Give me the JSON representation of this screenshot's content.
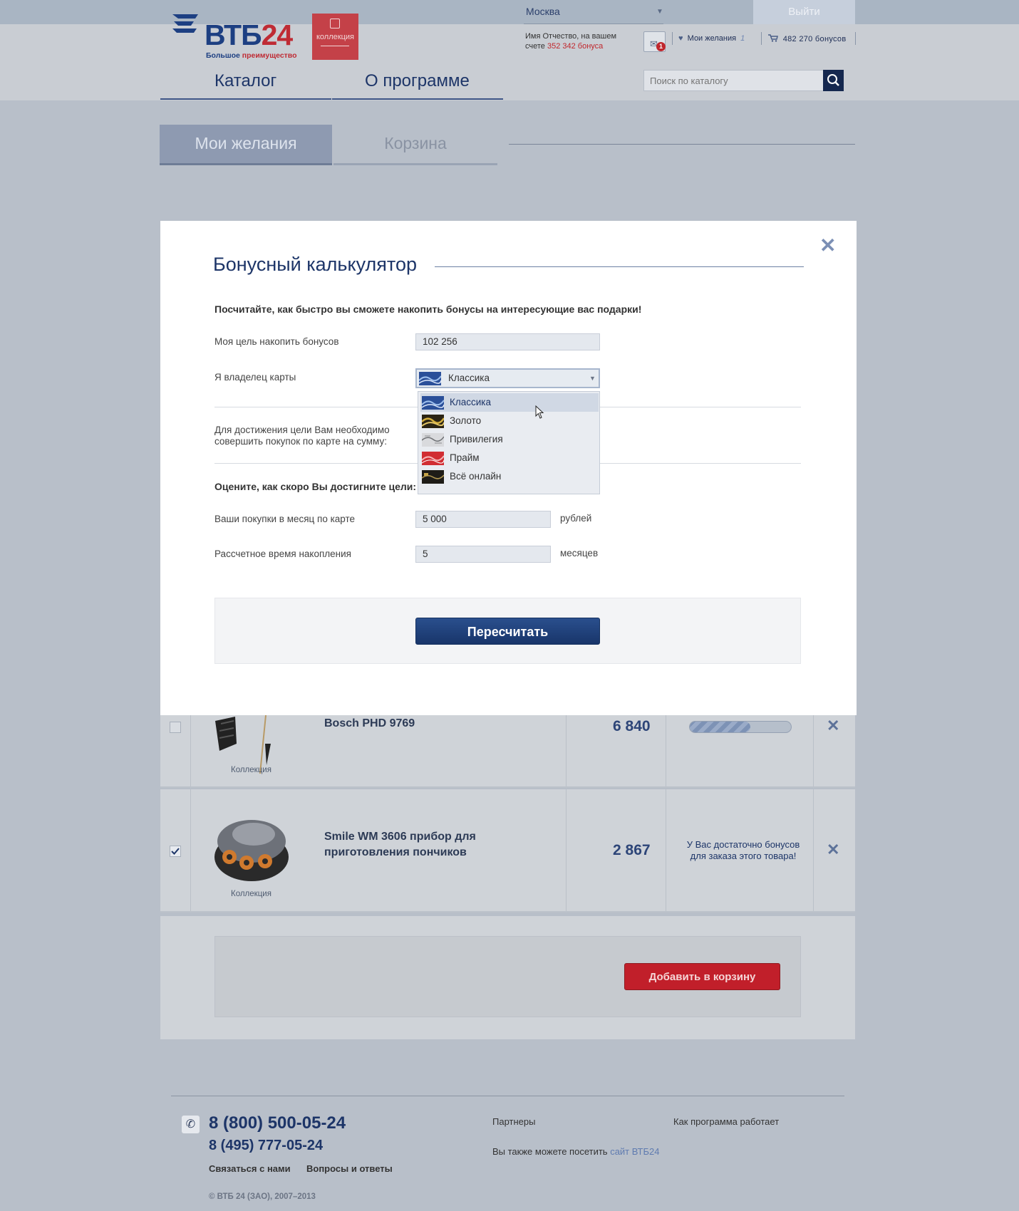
{
  "header": {
    "logo_text_main": "ВТБ",
    "logo_text_num": "24",
    "logo_sub_a": "Большое ",
    "logo_sub_b": "преимущество",
    "kollekciya": "коллекция",
    "city": "Москва",
    "logout": "Выйти",
    "user_line1": "Имя Отчество, на вашем",
    "user_line2_a": "счете ",
    "user_line2_b": "352 342 бонуса",
    "mail_badge": "1",
    "wish_label": "Мои желания",
    "wish_count": "1",
    "cart_label": "482 270 бонусов",
    "nav": [
      "Каталог",
      "О программе"
    ],
    "search_placeholder": "Поиск по каталогу"
  },
  "tabs": {
    "wish": "Мои желания",
    "cart": "Корзина"
  },
  "items": [
    {
      "name": "Bosch PHD 9769",
      "price": "6 840",
      "collection": "Коллекция",
      "checked": false,
      "progress": 0.6
    },
    {
      "name_line1": "Smile WM 3606 прибор для",
      "name_line2": "приготовления пончиков",
      "price": "2 867",
      "collection": "Коллекция",
      "checked": true,
      "status_line1": "У Вас достаточно бонусов",
      "status_line2": "для заказа этого товара!"
    }
  ],
  "add_to_cart": "Добавить в корзину",
  "modal": {
    "title": "Бонусный калькулятор",
    "lead": "Посчитайте, как быстро вы сможете накопить бонусы на интересующие вас подарки!",
    "goal_label": "Моя цель накопить бонусов",
    "goal_value": "102 256",
    "card_label": "Я владелец карты",
    "card_selected": "Классика",
    "need_line1": "Для достижения цели Вам необходимо",
    "need_line2": "совершить покупок по карте на сумму:",
    "estimate_title": "Оцените, как скоро Вы достигните цели:",
    "monthly_label": "Ваши покупки в месяц по карте",
    "monthly_value": "5 000",
    "monthly_unit": "рублей",
    "time_label": "Рассчетное время накопления",
    "time_value": "5",
    "time_unit": "месяцев",
    "recalc": "Пересчитать",
    "card_options": [
      "Классика",
      "Золото",
      "Привилегия",
      "Прайм",
      "Всё онлайн"
    ]
  },
  "footer": {
    "phone1": "8 (800) 500-05-24",
    "phone2": "8 (495) 777-05-24",
    "contact": "Связаться с нами",
    "faq": "Вопросы и ответы",
    "partners": "Партнеры",
    "how": "Как программа работает",
    "visit_a": "Вы также можете посетить ",
    "visit_b": "сайт ВТБ24",
    "copyright": "© ВТБ 24 (ЗАО), 2007–2013"
  },
  "colors": {
    "brand_blue": "#1d3568",
    "brand_red": "#c11f2a",
    "overlay_bg": "#b8bfc9"
  }
}
